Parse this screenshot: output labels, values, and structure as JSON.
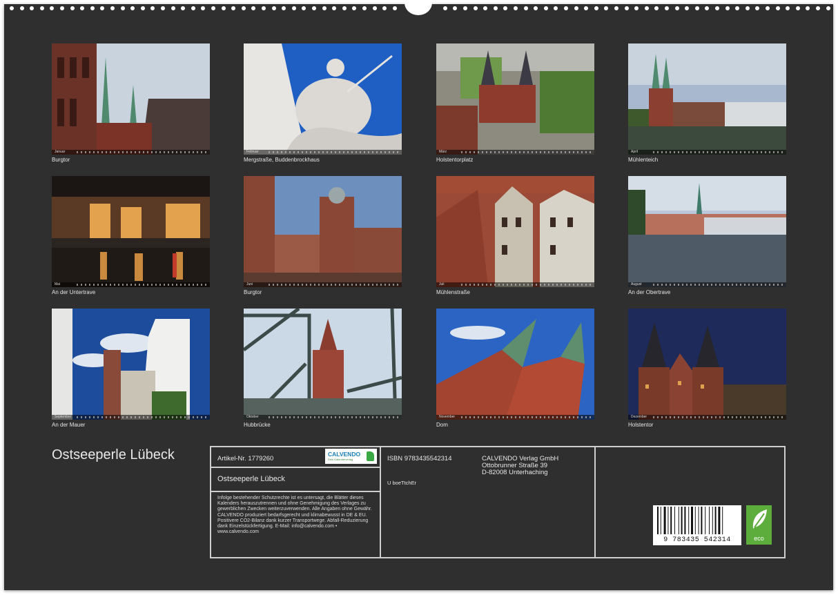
{
  "calendar": {
    "title": "Ostseeperle Lübeck",
    "months": [
      {
        "label": "Januar",
        "caption": "Burgtor"
      },
      {
        "label": "Februar",
        "caption": "Mergstraße, Buddenbrockhaus"
      },
      {
        "label": "März",
        "caption": "Holstentorplatz"
      },
      {
        "label": "April",
        "caption": "Mühlenteich"
      },
      {
        "label": "Mai",
        "caption": "An der Untertrave"
      },
      {
        "label": "Juni",
        "caption": "Burgtor"
      },
      {
        "label": "Juli",
        "caption": "Mühlenstraße"
      },
      {
        "label": "August",
        "caption": "An der Obertrave"
      },
      {
        "label": "September",
        "caption": "An der Mauer"
      },
      {
        "label": "Oktober",
        "caption": "Hubbrücke"
      },
      {
        "label": "November",
        "caption": "Dom"
      },
      {
        "label": "Dezember",
        "caption": "Holstentor"
      }
    ]
  },
  "info": {
    "article": "Artikel-Nr. 1779260",
    "product_title": "Ostseeperle Lübeck",
    "legal": "Infolge bestehender Schutzrechte ist es untersagt, die Blätter dieses Kalenders herauszutrennen und ohne Genehmigung des Verlages zu gewerblichen Zwecken weiterzuverwenden. Alle Angaben ohne Gewähr. CALVENDO produziert bedarfsgerecht und klimabewusst in DE & EU. Positivere CO2-Bilanz dank kurzer Transportwege. Abfall-Reduzierung dank Einzelstückfertigung. E-Mail: info@calvendo.com • www.calvendo.com",
    "isbn": "ISBN 9783435542314",
    "code": "U boeTtchEr",
    "publisher_name": "CALVENDO Verlag GmbH",
    "publisher_street": "Ottobrunner Straße 39",
    "publisher_city": "D-82008 Unterhaching",
    "logo_text": "CALVENDO",
    "logo_sub": "Dein Kalenderverlag",
    "barcode_number": "9 783435 542314",
    "eco_text": "eco"
  },
  "colors": {
    "sheet": "#2f2f2f",
    "border": "#cfcfcf",
    "text": "#e8e8e8",
    "eco_green": "#5cad3c",
    "logo_blue": "#1a7fb5"
  }
}
